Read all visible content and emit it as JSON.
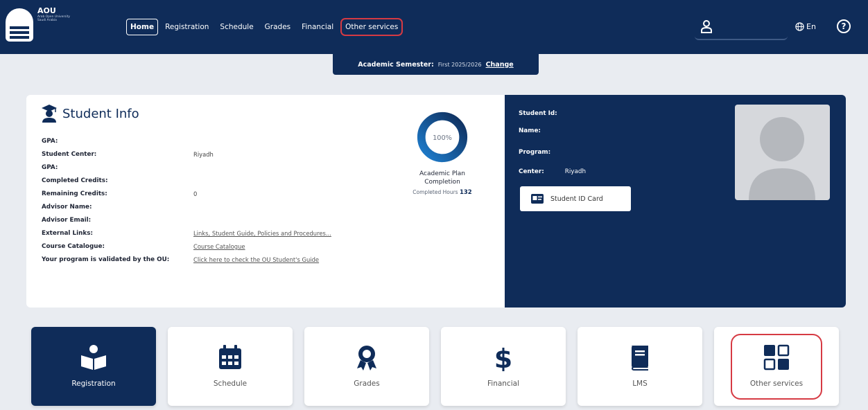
{
  "brand": {
    "name": "AOU",
    "subtitle_lines": [
      "Arab Open University",
      "Saudi Arabia"
    ]
  },
  "nav": {
    "items": [
      "Home",
      "Registration",
      "Schedule",
      "Grades",
      "Financial",
      "Other services"
    ],
    "active": "Home",
    "highlighted": "Other services"
  },
  "header": {
    "lang": "En",
    "help": "?"
  },
  "semester": {
    "label": "Academic Semester:",
    "value": "First 2025/2026",
    "change": "Change"
  },
  "student_info": {
    "title": "Student Info",
    "rows": [
      {
        "label": "GPA:",
        "value": ""
      },
      {
        "label": "Student Center:",
        "value": "Riyadh"
      },
      {
        "label": "GPA:",
        "value": ""
      },
      {
        "label": "Completed Credits:",
        "value": ""
      },
      {
        "label": "Remaining Credits:",
        "value": "0"
      },
      {
        "label": "Advisor Name:",
        "value": ""
      },
      {
        "label": "Advisor Email:",
        "value": ""
      },
      {
        "label": "External Links:",
        "value": "Links, Student Guide, Policies and Procedures..."
      },
      {
        "label": "Course Catalogue:",
        "value": "Course Catalogue"
      },
      {
        "label": "Your program is validated by the OU:",
        "value": "Click here to check the OU Student's Guide"
      }
    ],
    "plan": {
      "percent_text": "100%",
      "progress": 1.0,
      "caption_line1": "Academic Plan",
      "caption_line2": "Completion",
      "hours_label": "Completed Hours",
      "hours_value": "132"
    }
  },
  "profile": {
    "fields": [
      {
        "label": "Student Id:",
        "value": ""
      },
      {
        "label": "Name:",
        "value": ""
      },
      {
        "label": "Program:",
        "value": ""
      },
      {
        "label": "Center:",
        "value": "Riyadh"
      }
    ],
    "id_card_button": "Student ID Card"
  },
  "tiles": [
    {
      "label": "Registration",
      "icon": "reading-person-icon",
      "active": true
    },
    {
      "label": "Schedule",
      "icon": "calendar-icon",
      "active": false
    },
    {
      "label": "Grades",
      "icon": "award-ribbon-icon",
      "active": false
    },
    {
      "label": "Financial",
      "icon": "dollar-icon",
      "active": false
    },
    {
      "label": "LMS",
      "icon": "book-icon",
      "active": false
    },
    {
      "label": "Other services",
      "icon": "grid-squares-icon",
      "active": false,
      "highlighted": true
    }
  ],
  "colors": {
    "navy": "#0f2c59",
    "highlight_red": "#d63a43",
    "background": "#e9ecf1"
  }
}
